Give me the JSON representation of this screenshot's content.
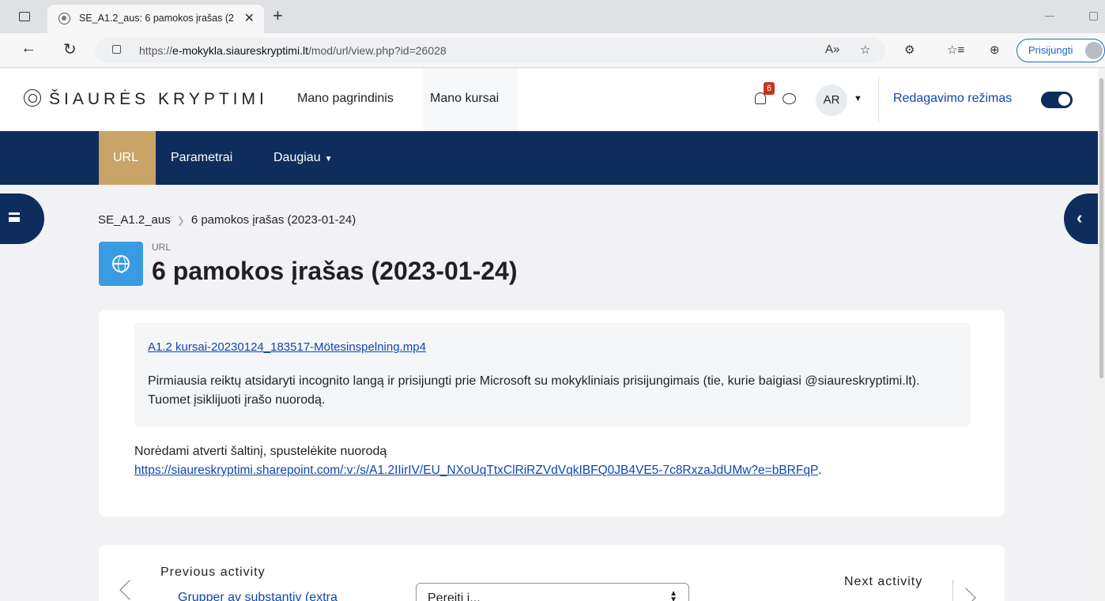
{
  "browser": {
    "tab_title": "SE_A1.2_aus: 6 pamokos įrašas (2",
    "url_prefix": "https://",
    "url_host": "e-mokykla.siaureskryptimi.lt",
    "url_path": "/mod/url/view.php?id=26028",
    "signin_label": "Prisijungti"
  },
  "header": {
    "logo_text": "ŠIAURĖS KRYPTIMI",
    "nav_items": [
      "Mano pagrindinis",
      "Mano kursai"
    ],
    "notification_count": "6",
    "avatar_initials": "AR",
    "edit_mode_label": "Redagavimo režimas",
    "edit_mode_on": true
  },
  "secondary_nav": {
    "tabs": [
      "URL",
      "Parametrai",
      "Daugiau"
    ]
  },
  "breadcrumb": {
    "course": "SE_A1.2_aus",
    "current": "6 pamokos įrašas (2023-01-24)"
  },
  "activity": {
    "type_label": "URL",
    "title": "6 pamokos įrašas (2023-01-24)",
    "intro_link": "A1.2 kursai-20230124_183517-Mötesinspelning.mp4",
    "intro_text": "Pirmiausia reiktų atsidaryti incognito langą ir prisijungti prie Microsoft su mokykliniais prisijungimais (tie, kurie baigiasi @siaureskryptimi.lt). Tuomet įsiklijuoti įrašo nuorodą.",
    "open_instruction": "Norėdami atverti šaltinį, spustelėkite nuorodą",
    "resource_url": "https://siaureskryptimi.sharepoint.com/:v:/s/A1.2IIirIV/EU_NXoUqTtxClRiRZVdVqkIBFQ0JB4VE5-7c8RxzaJdUMw?e=bBRFqP"
  },
  "activity_nav": {
    "previous_label": "Previous activity",
    "previous_link": "Grupper av substantiv (extra",
    "jump_placeholder": "Pereiti į...",
    "next_label": "Next activity"
  }
}
